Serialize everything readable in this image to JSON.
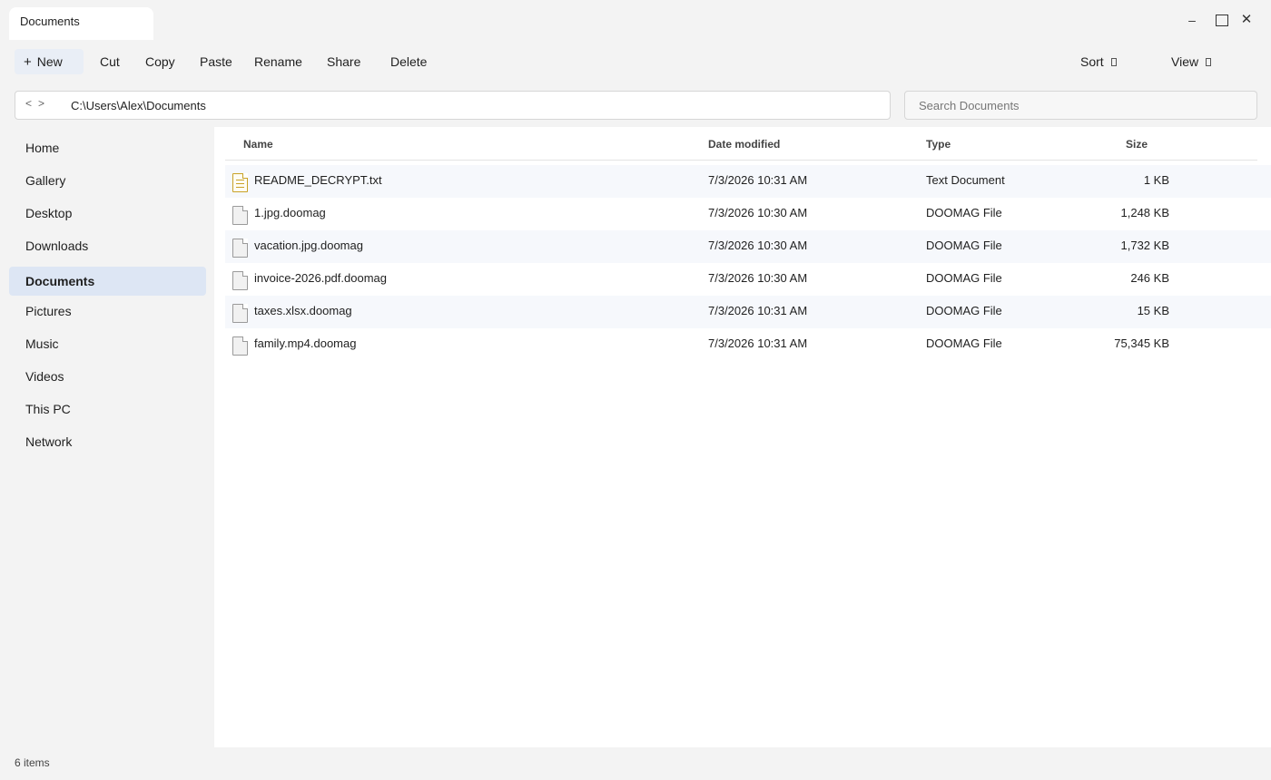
{
  "window": {
    "tab_title": "Documents",
    "minimize": "–",
    "close": "✕"
  },
  "toolbar": {
    "new_plus": "+",
    "new_label": "New",
    "cut_label": "Cut",
    "copy_label": "Copy",
    "paste_label": "Paste",
    "rename_label": "Rename",
    "share_label": "Share",
    "delete_label": "Delete",
    "sort_label": "Sort",
    "view_label": "View"
  },
  "address": {
    "back": "<",
    "forward": ">",
    "path": "C:\\Users\\Alex\\Documents"
  },
  "search": {
    "placeholder": "Search Documents"
  },
  "sidebar": {
    "items": [
      {
        "label": "Home"
      },
      {
        "label": "Gallery"
      },
      {
        "label": "Desktop"
      },
      {
        "label": "Downloads"
      },
      {
        "label": "Documents",
        "active": true
      },
      {
        "label": "Pictures"
      },
      {
        "label": "Music"
      },
      {
        "label": "Videos"
      },
      {
        "label": "This PC"
      },
      {
        "label": "Network"
      }
    ]
  },
  "files": {
    "columns": [
      "Name",
      "Date modified",
      "Type",
      "Size"
    ],
    "rows": [
      {
        "name": "README_DECRYPT.txt",
        "date": "7/3/2026 10:31 AM",
        "type": "Text Document",
        "size": "1 KB",
        "icon": "text-file-icon"
      },
      {
        "name": "1.jpg.doomag",
        "date": "7/3/2026 10:30 AM",
        "type": "DOOMAG File",
        "size": "1,248 KB",
        "icon": "file-icon"
      },
      {
        "name": "vacation.jpg.doomag",
        "date": "7/3/2026 10:30 AM",
        "type": "DOOMAG File",
        "size": "1,732 KB",
        "icon": "file-icon"
      },
      {
        "name": "invoice-2026.pdf.doomag",
        "date": "7/3/2026 10:30 AM",
        "type": "DOOMAG File",
        "size": "246 KB",
        "icon": "file-icon"
      },
      {
        "name": "taxes.xlsx.doomag",
        "date": "7/3/2026 10:31 AM",
        "type": "DOOMAG File",
        "size": "15 KB",
        "icon": "file-icon"
      },
      {
        "name": "family.mp4.doomag",
        "date": "7/3/2026 10:31 AM",
        "type": "DOOMAG File",
        "size": "75,345 KB",
        "icon": "file-icon"
      }
    ]
  },
  "status": {
    "item_count": "6 items"
  },
  "colors": {
    "accent_active": "#dde6f4",
    "row_alt": "#f6f8fc",
    "text_file_accent": "#c9a227"
  }
}
